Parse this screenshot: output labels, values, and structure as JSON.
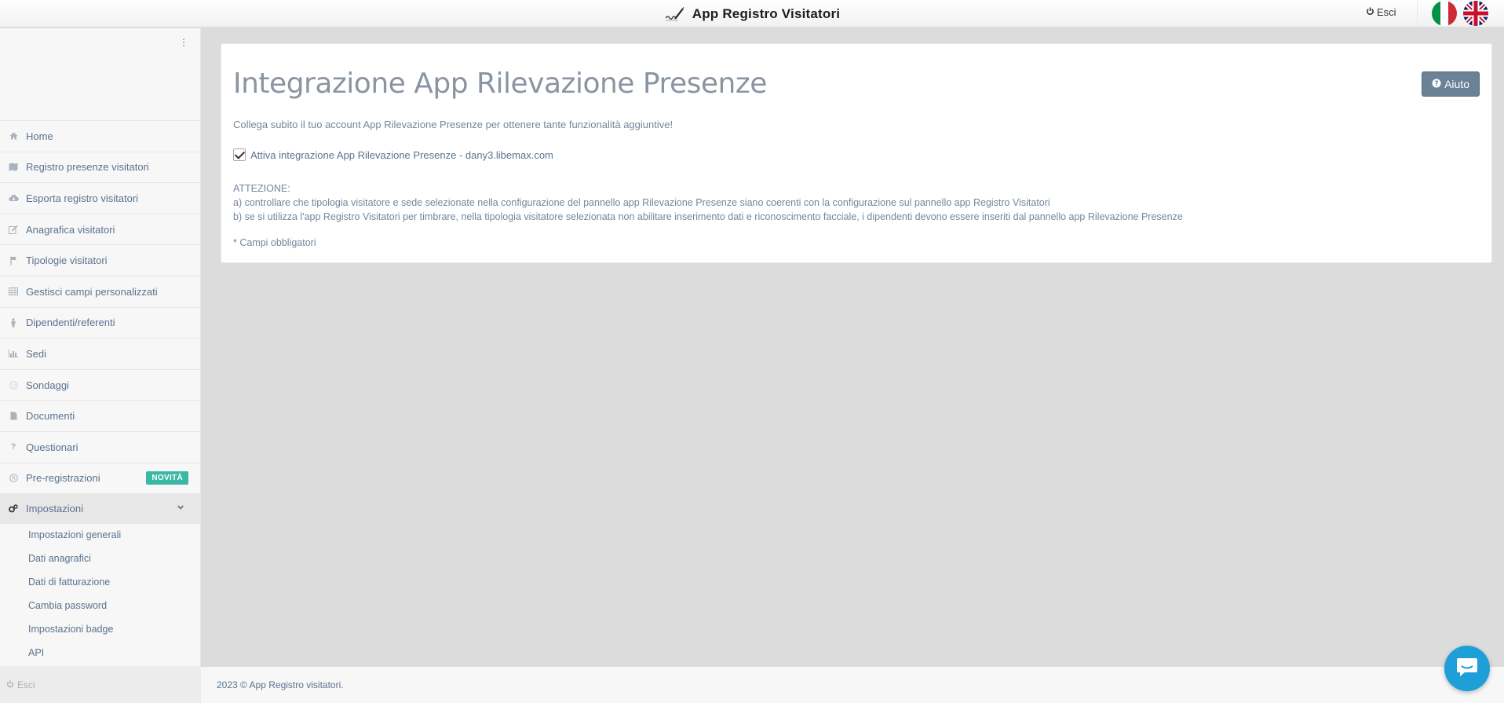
{
  "header": {
    "title": "App Registro Visitatori",
    "logout_label": "Esci"
  },
  "sidebar": {
    "items": [
      {
        "label": "Home",
        "icon": "home-icon"
      },
      {
        "label": "Registro presenze visitatori",
        "icon": "map-icon"
      },
      {
        "label": "Esporta registro visitatori",
        "icon": "cloud-download-icon"
      },
      {
        "label": "Anagrafica visitatori",
        "icon": "edit-icon"
      },
      {
        "label": "Tipologie visitatori",
        "icon": "flag-icon"
      },
      {
        "label": "Gestisci campi personalizzati",
        "icon": "table-icon"
      },
      {
        "label": "Dipendenti/referenti",
        "icon": "male-icon"
      },
      {
        "label": "Sedi",
        "icon": "bar-chart-icon"
      },
      {
        "label": "Sondaggi",
        "icon": "smile-icon"
      },
      {
        "label": "Documenti",
        "icon": "file-icon"
      },
      {
        "label": "Questionari",
        "icon": "question-icon"
      },
      {
        "label": "Pre-registrazioni",
        "icon": "registered-icon",
        "badge": "NOVITÀ"
      },
      {
        "label": "Impostazioni",
        "icon": "cogs-icon"
      }
    ],
    "submenu": [
      "Impostazioni generali",
      "Dati anagrafici",
      "Dati di fatturazione",
      "Cambia password",
      "Impostazioni badge",
      "API"
    ],
    "footer_logout": "Esci"
  },
  "main": {
    "title": "Integrazione App Rilevazione Presenze",
    "help_label": "Aiuto",
    "intro": "Collega subito il tuo account App Rilevazione Presenze per ottenere tante funzionalità aggiuntive!",
    "checkbox_label": "Attiva integrazione App Rilevazione Presenze - dany3.libemax.com",
    "checkbox_checked": true,
    "warning_title": "ATTEZIONE:",
    "warning_a": "a) controllare che tipologia visitatore e sede selezionate nella configurazione del pannello app Rilevazione Presenze siano coerenti con la configurazione sul pannello app Registro Visitatori",
    "warning_b": "b) se si utilizza l'app Registro Visitatori per timbrare, nella tipologia visitatore selezionata non abilitare inserimento dati e riconoscimento facciale, i dipendenti devono essere inseriti dal pannello app Rilevazione Presenze",
    "required_note": "* Campi obbligatori"
  },
  "footer": {
    "copyright": "2023 © App Registro visitatori."
  },
  "colors": {
    "badge": "#3bb8a4",
    "help_button": "#6b8296",
    "chat": "#1e9fd8"
  }
}
